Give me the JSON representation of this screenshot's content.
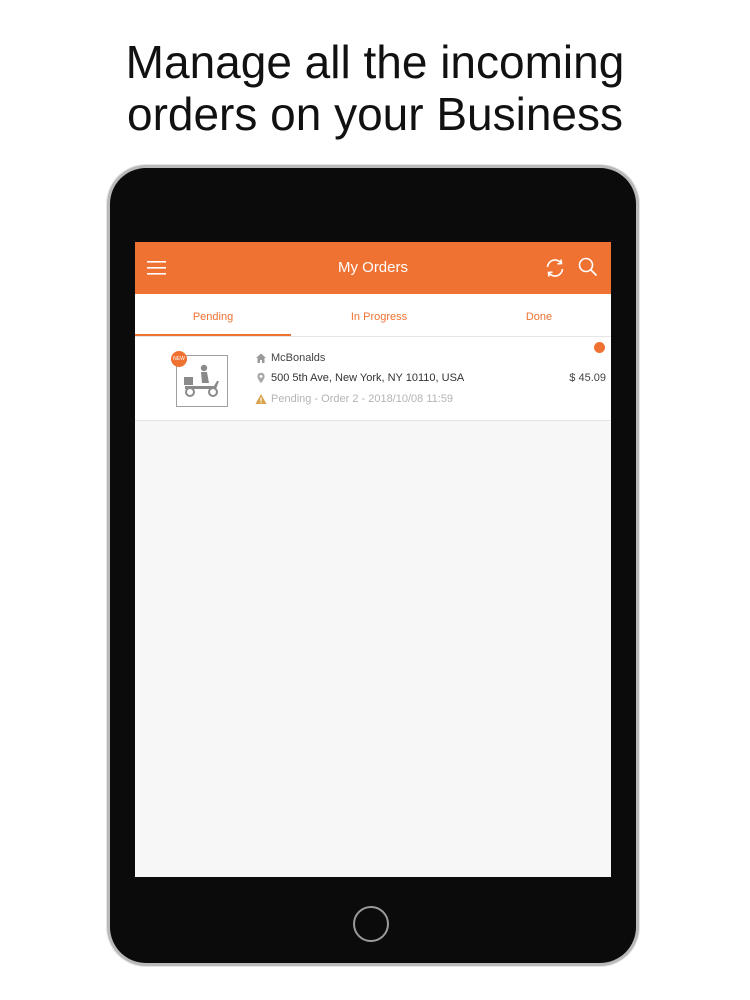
{
  "headline": {
    "line1": "Manage all the incoming",
    "line2": "orders on your Business"
  },
  "app": {
    "title": "My Orders",
    "accent_color": "#ef7232",
    "icons": [
      "menu-icon",
      "refresh-icon",
      "search-icon"
    ]
  },
  "tabs": [
    {
      "label": "Pending",
      "active": true
    },
    {
      "label": "In Progress",
      "active": false
    },
    {
      "label": "Done",
      "active": false
    }
  ],
  "orders": [
    {
      "badge": "NEW",
      "business": "McBonalds",
      "address": "500 5th Ave, New York, NY 10110, USA",
      "status": "Pending - Order 2 - 2018/10/08 11:59",
      "price": "$ 45.09",
      "unread": true,
      "thumbnail_icon": "delivery-scooter-icon"
    }
  ]
}
